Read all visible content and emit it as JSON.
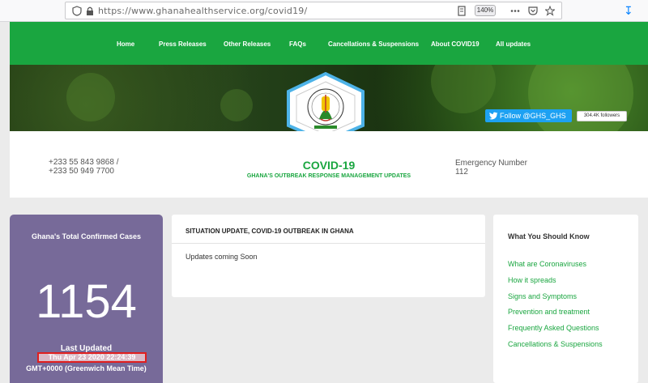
{
  "browser": {
    "url": "https://www.ghanahealthservice.org/covid19/",
    "zoom": "140%"
  },
  "nav": {
    "items": [
      "Home",
      "Press Releases",
      "Other Releases",
      "FAQs",
      "Cancellations & Suspensions",
      "About COVID19",
      "All updates"
    ]
  },
  "twitter": {
    "button_label": "Follow @GHS_GHS",
    "followers": "304.4K followers"
  },
  "info": {
    "phone_line1": "+233 55 843 9868 /",
    "phone_line2": "+233 50 949 7700",
    "title": "COVID-19",
    "subtitle": "GHANA'S OUTBREAK RESPONSE MANAGEMENT UPDATES",
    "emergency_label": "Emergency Number",
    "emergency_number": "112"
  },
  "cases": {
    "title": "Ghana's Total Confirmed Cases",
    "count": "1154",
    "last_updated_label": "Last Updated",
    "date": "Thu Apr 23 2020 22:24:39",
    "timezone": "GMT+0000 (Greenwich Mean Time)"
  },
  "situation": {
    "title": "SITUATION UPDATE, COVID-19 OUTBREAK IN GHANA",
    "body": "Updates coming Soon"
  },
  "know": {
    "title": "What You Should Know",
    "links": [
      "What are Coronaviruses",
      "How it spreads",
      "Signs and Symptoms",
      "Prevention and treatment",
      "Frequently Asked Questions",
      "Cancellations & Suspensions"
    ]
  },
  "colors": {
    "brand_green": "#1aa640",
    "card_purple": "#776a99",
    "twitter_blue": "#1da1f2",
    "highlight_red": "#e01e1e"
  }
}
